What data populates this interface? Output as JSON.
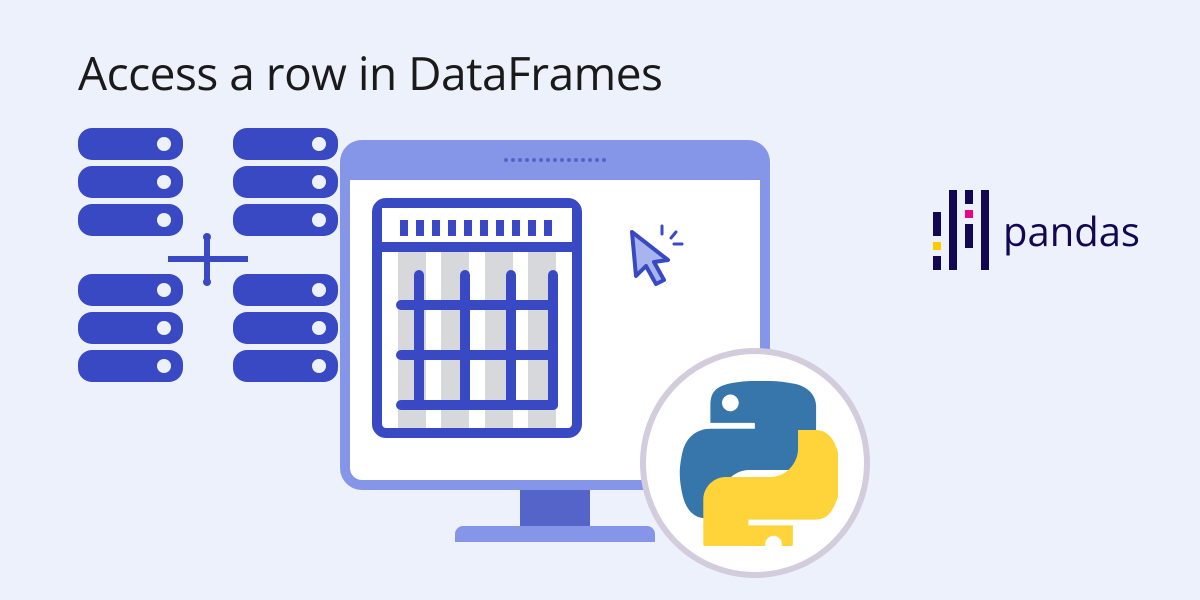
{
  "title": "Access a row in DataFrames",
  "pandas": {
    "label": "pandas"
  },
  "icons": {
    "servers": "server-cluster-icon",
    "monitor": "monitor-icon",
    "calendar": "data-grid-icon",
    "cursor": "cursor-click-icon",
    "python": "python-logo-icon",
    "pandas_bars": "pandas-logo-icon"
  },
  "colors": {
    "bg": "#edf1fc",
    "primary": "#3949c4",
    "primary_light": "#8596e8",
    "pandas_navy": "#130754",
    "pandas_pink": "#e70488",
    "pandas_yellow": "#ffca00",
    "python_blue": "#3776ab",
    "python_yellow": "#ffd43b"
  }
}
